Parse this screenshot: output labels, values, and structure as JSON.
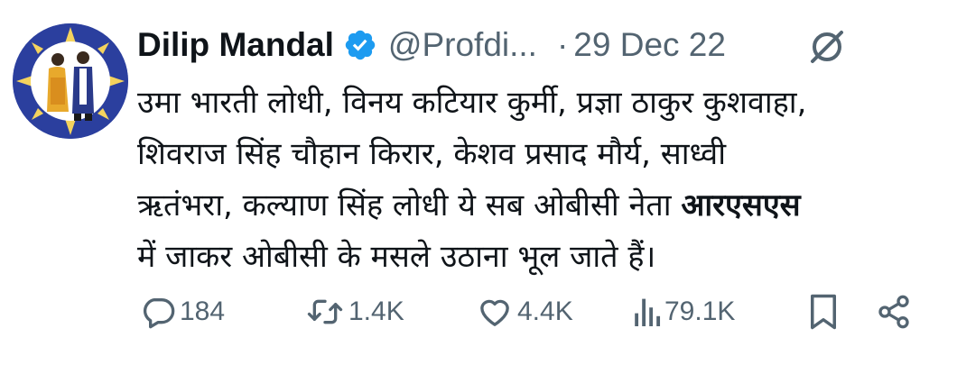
{
  "author": {
    "name": "Dilip Mandal",
    "handle": "@Profdi...",
    "separator": "·",
    "date": "29 Dec 22"
  },
  "tweet": {
    "lines": [
      "उमा भारती लोधी, विनय कटियार कुर्मी, प्रज्ञा ठाकुर कुशवाहा,",
      "शिवराज सिंह चौहान किरार, केशव प्रसाद मौर्य, साध्वी",
      "ऋतंभरा, कल्याण सिंह लोधी ये सब ओबीसी नेता ",
      "में जाकर ओबीसी के मसले उठाना भूल जाते हैं।"
    ],
    "bold_word": "आरएसएस"
  },
  "actions": {
    "replies": "184",
    "retweets": "1.4K",
    "likes": "4.4K",
    "views": "79.1K"
  },
  "icons": {
    "verified": "verified-badge-icon",
    "edit": "edited-icon",
    "reply": "reply-icon",
    "retweet": "retweet-icon",
    "like": "heart-icon",
    "views": "views-icon",
    "bookmark": "bookmark-icon",
    "share": "share-icon"
  },
  "colors": {
    "text": "#0f1419",
    "secondary": "#536471",
    "verified": "#1d9bf0",
    "avatar_bg": "#2b3f9e"
  }
}
